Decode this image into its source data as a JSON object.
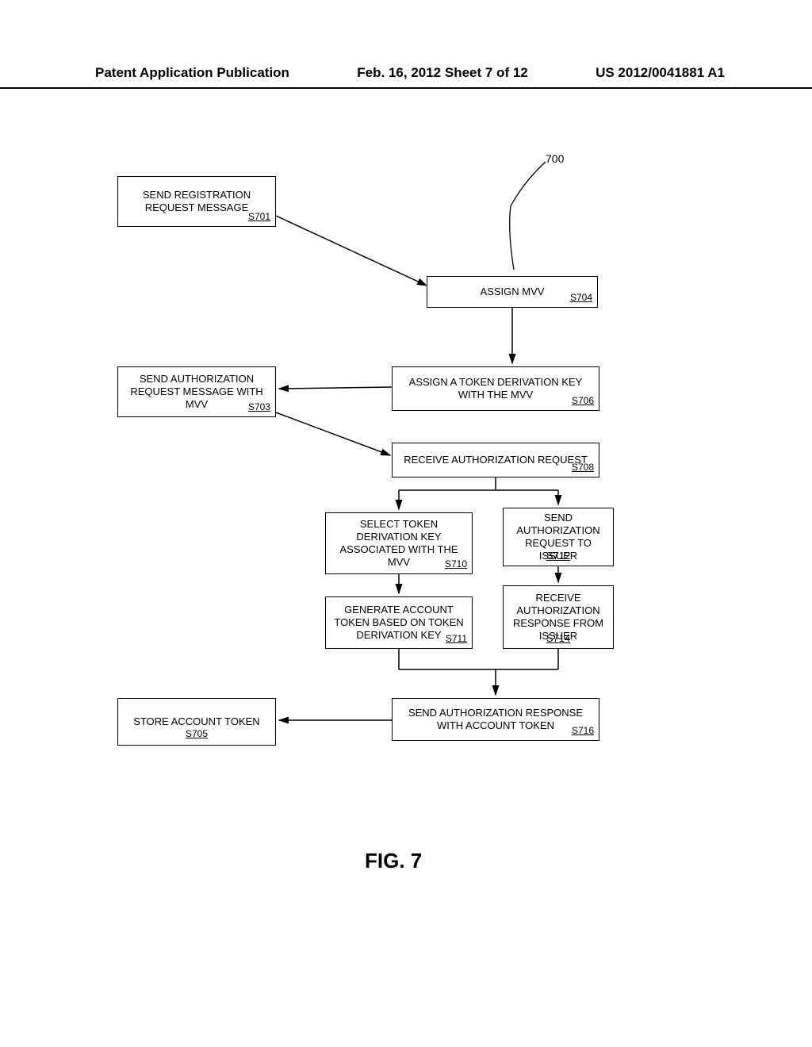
{
  "header": {
    "left": "Patent Application Publication",
    "center": "Feb. 16, 2012  Sheet 7 of 12",
    "right": "US 2012/0041881 A1"
  },
  "ref": {
    "num": "700"
  },
  "boxes": {
    "s701": {
      "text": "SEND REGISTRATION REQUEST MESSAGE",
      "step": "S701"
    },
    "s704": {
      "text": "ASSIGN MVV",
      "step": "S704"
    },
    "s703": {
      "text": "SEND AUTHORIZATION REQUEST MESSAGE WITH MVV",
      "step": "S703"
    },
    "s706": {
      "text": "ASSIGN A TOKEN DERIVATION KEY WITH THE MVV",
      "step": "S706"
    },
    "s708": {
      "text": "RECEIVE AUTHORIZATION REQUEST",
      "step": "S708"
    },
    "s710": {
      "text": "SELECT TOKEN DERIVATION KEY ASSOCIATED WITH THE MVV",
      "step": "S710"
    },
    "s712": {
      "text": "SEND AUTHORIZATION REQUEST TO ISSUER",
      "step": "S712"
    },
    "s711": {
      "text": "GENERATE ACCOUNT TOKEN BASED ON TOKEN DERIVATION KEY",
      "step": "S711"
    },
    "s714": {
      "text": "RECEIVE AUTHORIZATION RESPONSE FROM ISSUER",
      "step": "S714"
    },
    "s716": {
      "text": "SEND AUTHORIZATION RESPONSE WITH ACCOUNT TOKEN",
      "step": "S716"
    },
    "s705": {
      "text": "STORE ACCOUNT TOKEN",
      "step": "S705"
    }
  },
  "figure_label": "FIG. 7"
}
